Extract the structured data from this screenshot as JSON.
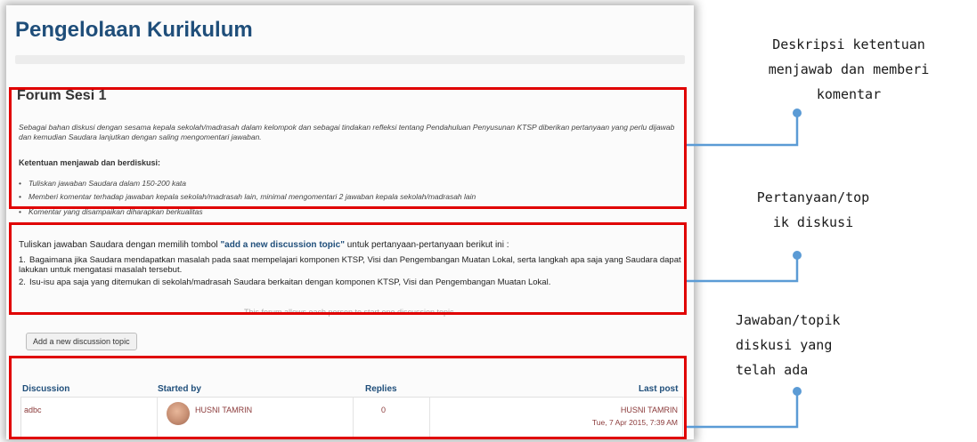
{
  "page": {
    "course_title": "Pengelolaan Kurikulum",
    "forum_title": "Forum Sesi 1",
    "intro_text": "Sebagai bahan diskusi dengan sesama kepala sekolah/madrasah dalam kelompok dan sebagai tindakan refleksi tentang Pendahuluan Penyusunan KTSP diberikan pertanyaan yang perlu dijawab dan kemudian Saudara lanjutkan dengan saling mengomentari jawaban.",
    "rules_heading": "Ketentuan menjawab dan berdiskusi:",
    "rules": [
      "Tuliskan jawaban Saudara dalam 150-200 kata",
      "Memberi komentar terhadap jawaban kepala sekolah/madrasah lain, minimal mengomentari 2 jawaban kepala sekolah/madrasah lain",
      "Komentar yang disampaikan diharapkan berkualitas"
    ],
    "instruction_prefix": "Tuliskan jawaban Saudara dengan memilih tombol ",
    "instruction_bold": "\"add a new discussion topic\"",
    "instruction_suffix": " untuk pertanyaan-pertanyaan berikut ini :",
    "questions": [
      {
        "num": "1.",
        "text": "Bagaimana jika Saudara mendapatkan masalah pada saat mempelajari komponen KTSP, Visi dan Pengembangan Muatan Lokal, serta langkah apa saja yang Saudara dapat lakukan untuk mengatasi masalah tersebut."
      },
      {
        "num": "2.",
        "text": "Isu-isu apa saja yang ditemukan di sekolah/madrasah Saudara berkaitan dengan komponen KTSP, Visi dan Pengembangan Muatan Lokal."
      }
    ],
    "forum_note": "This forum allows each person to start one discussion topic.",
    "add_topic_button": "Add a new discussion topic",
    "table": {
      "headers": [
        "Discussion",
        "Started by",
        "Replies",
        "Last post"
      ],
      "rows": [
        {
          "discussion": "adbc",
          "started_by": "HUSNI TAMRIN",
          "replies": "0",
          "last_post_user": "HUSNI TAMRIN",
          "last_post_date": "Tue, 7 Apr 2015, 7:39 AM"
        }
      ]
    }
  },
  "annotations": [
    {
      "lines": [
        "Deskripsi ketentuan",
        "menjawab dan memberi",
        "komentar"
      ]
    },
    {
      "lines": [
        "Pertanyaan/top",
        "ik diskusi"
      ]
    },
    {
      "lines": [
        "Jawaban/topik",
        "diskusi yang",
        "telah ada"
      ]
    }
  ],
  "colors": {
    "highlight_box": "#e00000",
    "connector": "#5b9bd5",
    "title": "#1f4e7a",
    "link": "#8b3a3a"
  }
}
